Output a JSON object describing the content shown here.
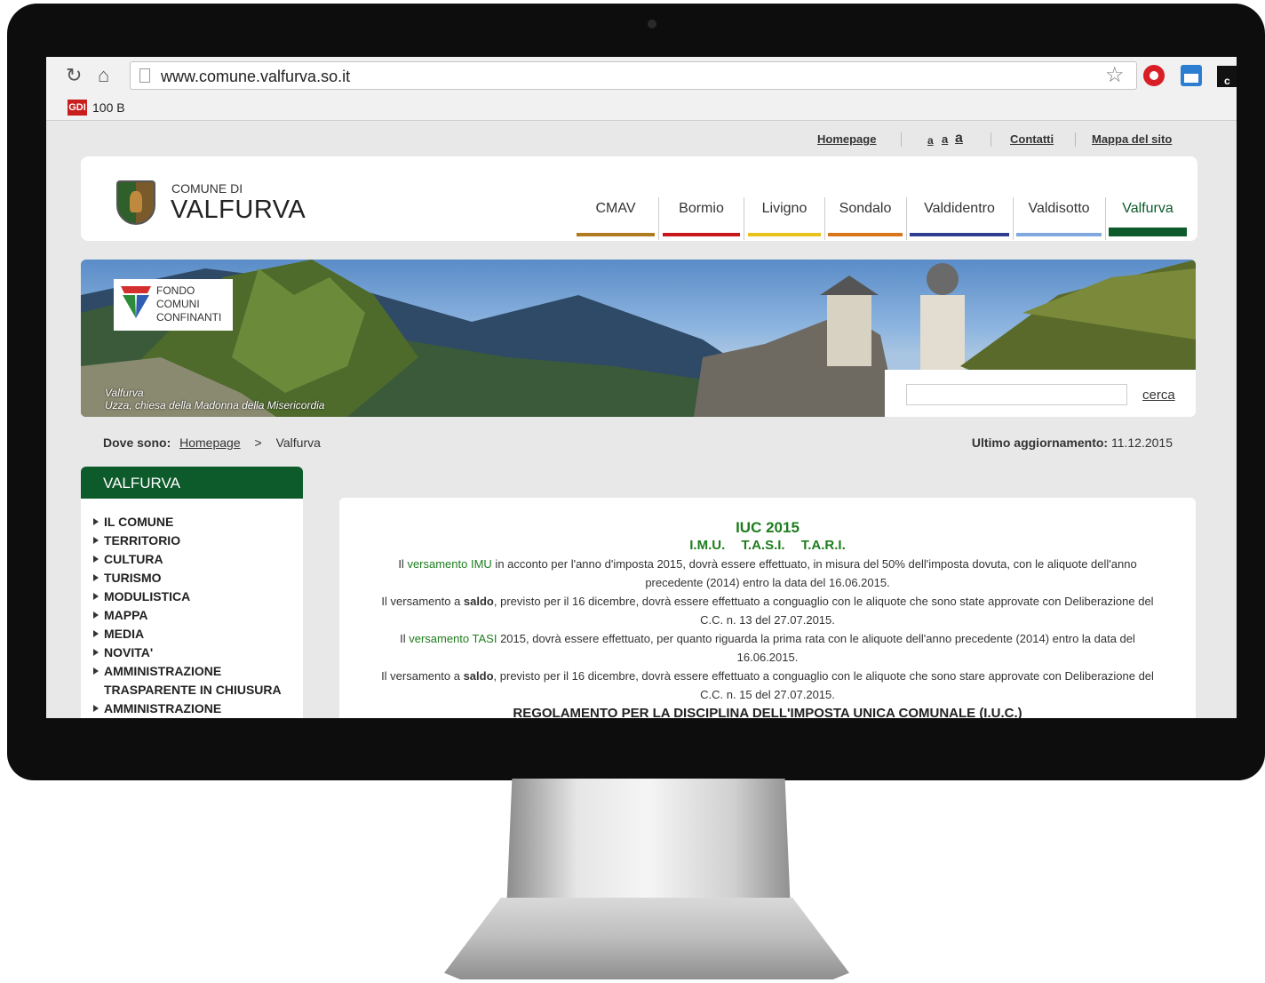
{
  "browser": {
    "url": "www.comune.valfurva.so.it",
    "bookmark_label": "100 B",
    "bookmark_icon_text": "GDI",
    "ext_dark_text": "c"
  },
  "site": {
    "top_links": {
      "homepage": "Homepage",
      "font_small": "a",
      "font_medium": "a",
      "font_large": "a",
      "contatti": "Contatti",
      "mappa": "Mappa del sito"
    },
    "header": {
      "comune_di": "COMUNE DI",
      "name": "VALFURVA"
    },
    "tabs": [
      {
        "label": "CMAV",
        "color": "#b07b1f"
      },
      {
        "label": "Bormio",
        "color": "#c8161d"
      },
      {
        "label": "Livigno",
        "color": "#e6c21a"
      },
      {
        "label": "Sondalo",
        "color": "#d9761c"
      },
      {
        "label": "Valdidentro",
        "color": "#2f3c8f"
      },
      {
        "label": "Valdisotto",
        "color": "#7fa9e0"
      },
      {
        "label": "Valfurva",
        "color": "#0d5a2a"
      }
    ],
    "banner": {
      "fondo_lines": [
        "FONDO",
        "COMUNI",
        "CONFINANTI"
      ],
      "caption_line1": "Valfurva",
      "caption_line2": "Uzza, chiesa della Madonna della Misericordia",
      "search_button": "cerca"
    },
    "breadcrumb": {
      "label": "Dove sono:",
      "home": "Homepage",
      "sep": ">",
      "current": "Valfurva"
    },
    "updated": {
      "label": "Ultimo aggiornamento:",
      "date": "11.12.2015"
    },
    "sidebar": {
      "title": "VALFURVA",
      "items": [
        "IL COMUNE",
        "TERRITORIO",
        "CULTURA",
        "TURISMO",
        "MODULISTICA",
        "MAPPA",
        "MEDIA",
        "NOVITA'",
        "AMMINISTRAZIONE TRASPARENTE IN CHIUSURA",
        "AMMINISTRAZIONE"
      ]
    },
    "content": {
      "title": "IUC 2015",
      "subtitle": "I.M.U. T.A.S.I. T.A.R.I.",
      "p1_link": "versamento IMU",
      "p1_pre": "Il ",
      "p1_post": " in acconto per l'anno d'imposta 2015,  dovrà essere effettuato, in misura del 50% dell'imposta dovuta, con le aliquote dell'anno precedente (2014) entro la data del 16.06.2015.",
      "p2_pre": "Il versamento a ",
      "p2_bold": "saldo",
      "p2_post": ", previsto per il 16 dicembre, dovrà essere effettuato a conguaglio con le aliquote che sono state approvate  con Deliberazione del C.C. n. 13 del 27.07.2015.",
      "p3_pre": "Il ",
      "p3_link": "versamento TASI",
      "p3_post": " 2015, dovrà essere effettuato, per quanto riguarda la prima rata con le aliquote dell'anno precedente (2014) entro la data del 16.06.2015.",
      "p4_pre": "Il versamento a ",
      "p4_bold": "saldo",
      "p4_post": ", previsto per il 16 dicembre, dovrà essere effettuato a conguaglio con le aliquote che sono stare approvate con Deliberazione del C.C. n. 15 del 27.07.2015.",
      "regolamento": "REGOLAMENTO PER LA DISCIPLINA DELL'IMPOSTA UNICA COMUNALE (I.U.C.)"
    }
  }
}
